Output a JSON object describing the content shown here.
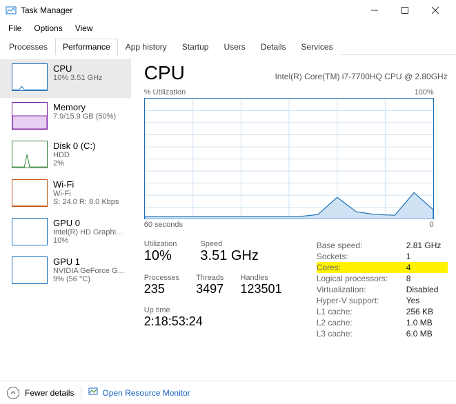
{
  "window": {
    "title": "Task Manager"
  },
  "menu": {
    "file": "File",
    "options": "Options",
    "view": "View"
  },
  "tabs": [
    {
      "label": "Processes"
    },
    {
      "label": "Performance"
    },
    {
      "label": "App history"
    },
    {
      "label": "Startup"
    },
    {
      "label": "Users"
    },
    {
      "label": "Details"
    },
    {
      "label": "Services"
    }
  ],
  "sidebar": {
    "items": [
      {
        "name": "CPU",
        "sub": "10% 3.51 GHz",
        "sub2": "",
        "color": "#1a6fb8"
      },
      {
        "name": "Memory",
        "sub": "7.9/15.9 GB (50%)",
        "sub2": "",
        "color": "#7b1fa2"
      },
      {
        "name": "Disk 0 (C:)",
        "sub": "HDD",
        "sub2": "2%",
        "color": "#2e7d32"
      },
      {
        "name": "Wi-Fi",
        "sub": "Wi-Fi",
        "sub2": "S: 24.0 R: 8.0 Kbps",
        "color": "#c0561a"
      },
      {
        "name": "GPU 0",
        "sub": "Intel(R) HD Graphi...",
        "sub2": "10%",
        "color": "#1a6fb8"
      },
      {
        "name": "GPU 1",
        "sub": "NVIDIA GeForce G...",
        "sub2": "9%  (56 °C)",
        "color": "#1a6fb8"
      }
    ]
  },
  "header": {
    "title": "CPU",
    "subtitle": "Intel(R) Core(TM) i7-7700HQ CPU @ 2.80GHz"
  },
  "chart": {
    "y_label": "% Utilization",
    "y_max": "100%",
    "x_left": "60 seconds",
    "x_right": "0"
  },
  "stats": {
    "utilization": {
      "label": "Utilization",
      "value": "10%"
    },
    "speed": {
      "label": "Speed",
      "value": "3.51 GHz"
    },
    "processes": {
      "label": "Processes",
      "value": "235"
    },
    "threads": {
      "label": "Threads",
      "value": "3497"
    },
    "handles": {
      "label": "Handles",
      "value": "123501"
    },
    "uptime": {
      "label": "Up time",
      "value": "2:18:53:24"
    }
  },
  "meta": {
    "base_speed": {
      "k": "Base speed:",
      "v": "2.81 GHz"
    },
    "sockets": {
      "k": "Sockets:",
      "v": "1"
    },
    "cores": {
      "k": "Cores:",
      "v": "4"
    },
    "logical": {
      "k": "Logical processors:",
      "v": "8"
    },
    "virtualization": {
      "k": "Virtualization:",
      "v": "Disabled"
    },
    "hyperv": {
      "k": "Hyper-V support:",
      "v": "Yes"
    },
    "l1": {
      "k": "L1 cache:",
      "v": "256 KB"
    },
    "l2": {
      "k": "L2 cache:",
      "v": "1.0 MB"
    },
    "l3": {
      "k": "L3 cache:",
      "v": "6.0 MB"
    }
  },
  "footer": {
    "fewer": "Fewer details",
    "orm": "Open Resource Monitor"
  },
  "chart_data": {
    "type": "line",
    "title": "% Utilization",
    "xlabel": "seconds ago",
    "ylabel": "% Utilization",
    "ylim": [
      0,
      100
    ],
    "x": [
      60,
      56,
      52,
      48,
      44,
      40,
      36,
      32,
      28,
      24,
      20,
      16,
      12,
      8,
      4,
      0
    ],
    "values": [
      2,
      2,
      2,
      2,
      2,
      2,
      2,
      2,
      2,
      4,
      18,
      6,
      4,
      3,
      22,
      8
    ]
  }
}
